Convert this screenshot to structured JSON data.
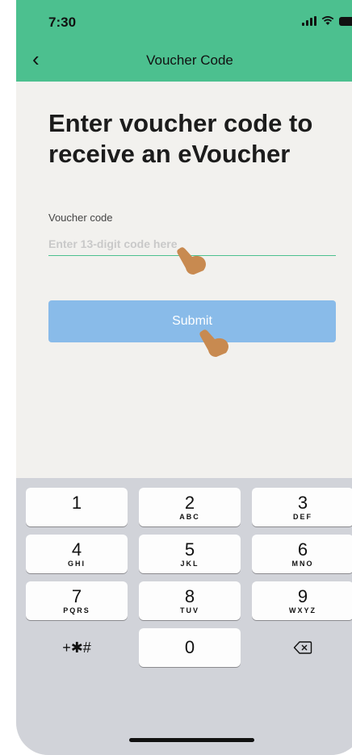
{
  "status_bar": {
    "time": "7:30"
  },
  "nav": {
    "back_glyph": "‹",
    "title": "Voucher Code"
  },
  "main": {
    "heading": "Enter voucher code to receive an eVoucher",
    "field_label": "Voucher code",
    "field_placeholder": "Enter 13-digit code here",
    "submit_label": "Submit"
  },
  "keypad": {
    "keys": [
      {
        "digit": "1",
        "letters": ""
      },
      {
        "digit": "2",
        "letters": "ABC"
      },
      {
        "digit": "3",
        "letters": "DEF"
      },
      {
        "digit": "4",
        "letters": "GHI"
      },
      {
        "digit": "5",
        "letters": "JKL"
      },
      {
        "digit": "6",
        "letters": "MNO"
      },
      {
        "digit": "7",
        "letters": "PQRS"
      },
      {
        "digit": "8",
        "letters": "TUV"
      },
      {
        "digit": "9",
        "letters": "WXYZ"
      },
      {
        "digit": "0",
        "letters": ""
      }
    ],
    "symbols_label": "+✱#",
    "delete_icon": "backspace-icon"
  },
  "colors": {
    "header": "#4cc08f",
    "button": "#89bbe9",
    "background": "#f2f1ee",
    "keyboard": "#d1d3d9"
  }
}
